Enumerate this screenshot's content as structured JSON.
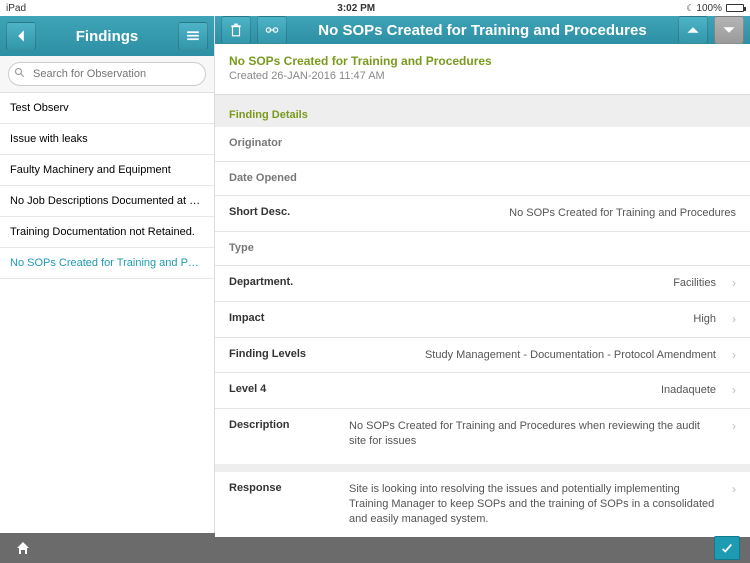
{
  "status": {
    "device": "iPad",
    "time": "3:02 PM",
    "battery_pct": "100%"
  },
  "sidebar": {
    "title": "Findings",
    "search_placeholder": "Search for Observation",
    "items": [
      {
        "label": "Test Observ"
      },
      {
        "label": "Issue with leaks"
      },
      {
        "label": "Faulty Machinery and Equipment"
      },
      {
        "label": "No Job Descriptions Documented at F…"
      },
      {
        "label": "Training Documentation not Retained."
      },
      {
        "label": "No SOPs Created for Training and P…"
      }
    ],
    "selected_index": 5
  },
  "detail": {
    "header_title": "No SOPs Created for Training and Procedures",
    "title": "No SOPs Created for Training and Procedures",
    "created": "Created 26-JAN-2016 11:47 AM",
    "section_label": "Finding Details",
    "rows": {
      "originator": {
        "label": "Originator",
        "value": ""
      },
      "date_opened": {
        "label": "Date Opened",
        "value": ""
      },
      "short_desc": {
        "label": "Short Desc.",
        "value": "No SOPs Created for Training and Procedures"
      },
      "type": {
        "label": "Type",
        "value": ""
      },
      "department": {
        "label": "Department.",
        "value": "Facilities"
      },
      "impact": {
        "label": "Impact",
        "value": "High"
      },
      "finding_levels": {
        "label": "Finding Levels",
        "value": "Study Management - Documentation - Protocol Amendment"
      },
      "level4": {
        "label": "Level 4",
        "value": "Inadaquete"
      },
      "description": {
        "label": "Description",
        "value": "No SOPs Created for Training and Procedures when reviewing the audit site for issues"
      },
      "response": {
        "label": "Response",
        "value": "Site is looking into resolving the issues and potentially implementing Training Manager to keep SOPs and the training of SOPs in a consolidated and easily managed system."
      }
    }
  }
}
